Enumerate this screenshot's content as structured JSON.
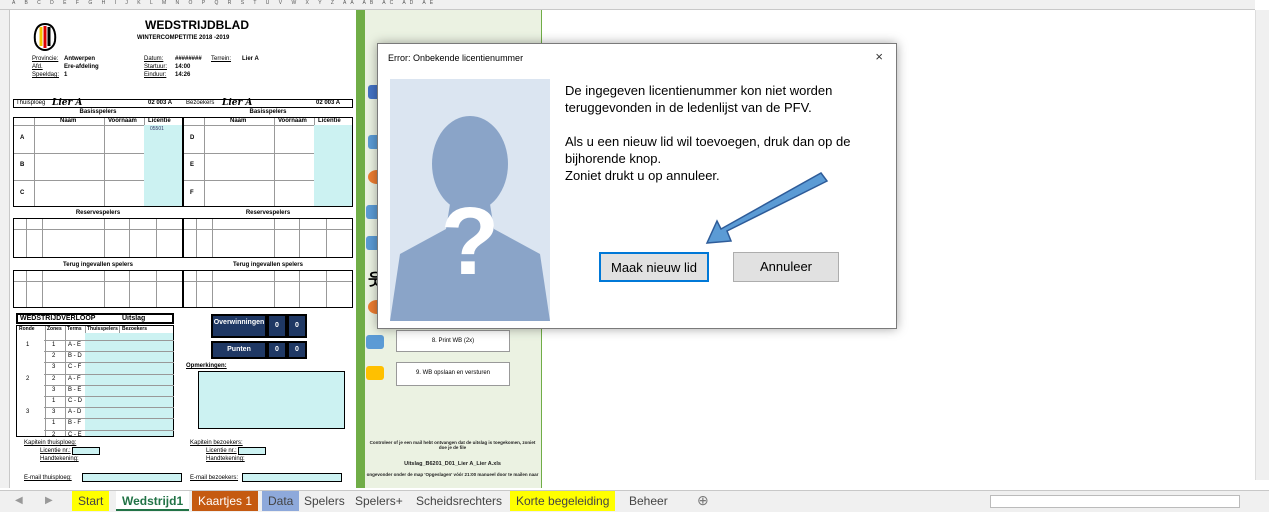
{
  "column_headers": "A B C D E F G H I J K L M N O P Q R S T U V W X Y    Z    AA    AB    AC    AD  AE",
  "sheet": {
    "title": "WEDSTRIJDBLAD",
    "subtitle": "WINTERCOMPETITIE 2018 -2019",
    "fields": {
      "provincie_label": "Provincie:",
      "provincie_value": "Antwerpen",
      "afd_label": "Afd.",
      "afd_value": "Ere-afdeling",
      "speeldag_label": "Speeldag:",
      "speeldag_value": "1",
      "datum_label": "Datum:",
      "datum_value": "########",
      "startuur_label": "Startuur:",
      "startuur_value": "14:00",
      "einduur_label": "Einduur:",
      "einduur_value": "14:26",
      "terrein_label": "Terrein:",
      "terrein_value": "Lier A"
    },
    "thuisploeg_label": "Thuisploeg",
    "thuisploeg_name": "Lier A",
    "thuisploeg_code": "02 003 A",
    "bezoekers_label": "Bezoekers",
    "bezoekers_name": "Lier A",
    "bezoekers_code": "02 003 A",
    "basisspelers": "Basisspelers",
    "reservespelers": "Reservespelers",
    "terug_ingevallen": "Terug ingevallen spelers",
    "col_naam": "Naam",
    "col_voornaam": "Voornaam",
    "col_licentie": "Licentie",
    "licentie_val": "05501",
    "groups_home": [
      "A",
      "B",
      "C"
    ],
    "groups_away": [
      "D",
      "E",
      "F"
    ],
    "wedstrijdverloop": "WEDSTRIJDVERLOOP",
    "uitslag": "Uitslag",
    "wv_cols": [
      "Ronde",
      "Zones",
      "Terms",
      "Thuisspelers",
      "Bezoekers"
    ],
    "wv_rows": [
      {
        "ronde": "1",
        "zone": "1",
        "pair": "A - E"
      },
      {
        "ronde": "",
        "zone": "2",
        "pair": "B - D"
      },
      {
        "ronde": "",
        "zone": "3",
        "pair": "C - F"
      },
      {
        "ronde": "2",
        "zone": "2",
        "pair": "A - F"
      },
      {
        "ronde": "",
        "zone": "3",
        "pair": "B - E"
      },
      {
        "ronde": "",
        "zone": "1",
        "pair": "C - D"
      },
      {
        "ronde": "3",
        "zone": "3",
        "pair": "A - D"
      },
      {
        "ronde": "",
        "zone": "1",
        "pair": "B - F"
      },
      {
        "ronde": "",
        "zone": "2",
        "pair": "C - E"
      }
    ],
    "overwinningen": "Overwinningen",
    "ov_home": "0",
    "ov_away": "0",
    "punten": "Punten",
    "pt_home": "0",
    "pt_away": "0",
    "opmerkingen": "Opmerkingen:",
    "kapitein_thuis": "Kapitein thuisploeg:",
    "kapitein_bez": "Kapitein bezoekers:",
    "licentie_nr": "Licentie nr.:",
    "handtekening": "Handtekening:",
    "email_thuis": "E-mail thuisploeg:",
    "email_bez": "E-mail bezoekers:"
  },
  "side_panel": {
    "btn_print": "8. Print WB (2x)",
    "btn_save": "9. WB opslaan en versturen",
    "info1": "Controleer of je een mail hebt ontvangen dat de uitslag is toegekomen, zoniet doe je de file",
    "info2": "Uitslag_B6201_D01_Lier A_Lier A.xls",
    "info3": "ongevonder onder de map 'Opgeslagen' vóór 21:00 manueel door te mailen naar"
  },
  "dialog": {
    "title": "Error: Onbekende licentienummer",
    "close": "×",
    "line1": "De ingegeven licentienummer kon niet worden teruggevonden in de ledenlijst van de PFV.",
    "line2": "Als u een nieuw lid wil toevoegen, druk dan op de bijhorende knop.",
    "line3": "Zoniet drukt u op annuleer.",
    "btn_new": "Maak nieuw lid",
    "btn_cancel": "Annuleer"
  },
  "tabs": [
    "Start",
    "Wedstrijd1",
    "Kaartjes 1",
    "Data",
    "Spelers",
    "Spelers+",
    "Scheidsrechters",
    "Korte begeleiding",
    "Beheer"
  ],
  "tab_colors": {
    "Start": "#ffff00",
    "Wedstrijd1": "#ffffff",
    "Kaartjes 1": "#c55a11",
    "Data": "#8ea9db",
    "Korte begeleiding": "#ffff00"
  },
  "add_sheet": "⊕"
}
